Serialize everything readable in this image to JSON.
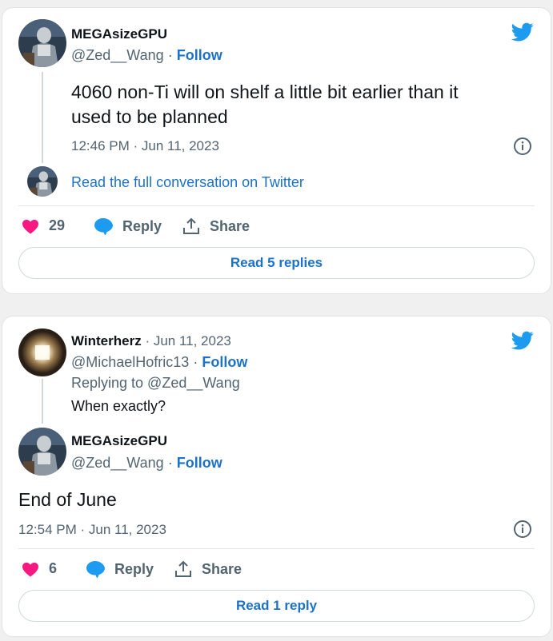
{
  "colors": {
    "accent": "#1d72c8",
    "heart": "#f91880",
    "bird": "#1d9bf0",
    "muted": "#536471"
  },
  "card1": {
    "author": {
      "name": "MEGAsizeGPU",
      "handle": "@Zed__Wang",
      "follow": "Follow",
      "sep": "·"
    },
    "text_line1": "4060 non-Ti will on shelf a little bit earlier than it",
    "text_line2": "used to be planned",
    "timestamp": "12:46 PM · Jun 11, 2023",
    "read_conversation": "Read the full conversation on Twitter",
    "likes": "29",
    "reply_label": "Reply",
    "share_label": "Share",
    "read_replies": "Read 5 replies"
  },
  "card2": {
    "parent": {
      "name": "Winterherz",
      "date": "· Jun 11, 2023",
      "handle": "@MichaelHofric13",
      "follow": "Follow",
      "sep": "·",
      "replying_to": "Replying to @Zed__Wang",
      "text": "When exactly?"
    },
    "author": {
      "name": "MEGAsizeGPU",
      "handle": "@Zed__Wang",
      "follow": "Follow",
      "sep": "·"
    },
    "text": "End of June",
    "timestamp": "12:54 PM · Jun 11, 2023",
    "likes": "6",
    "reply_label": "Reply",
    "share_label": "Share",
    "read_replies": "Read 1 reply"
  }
}
